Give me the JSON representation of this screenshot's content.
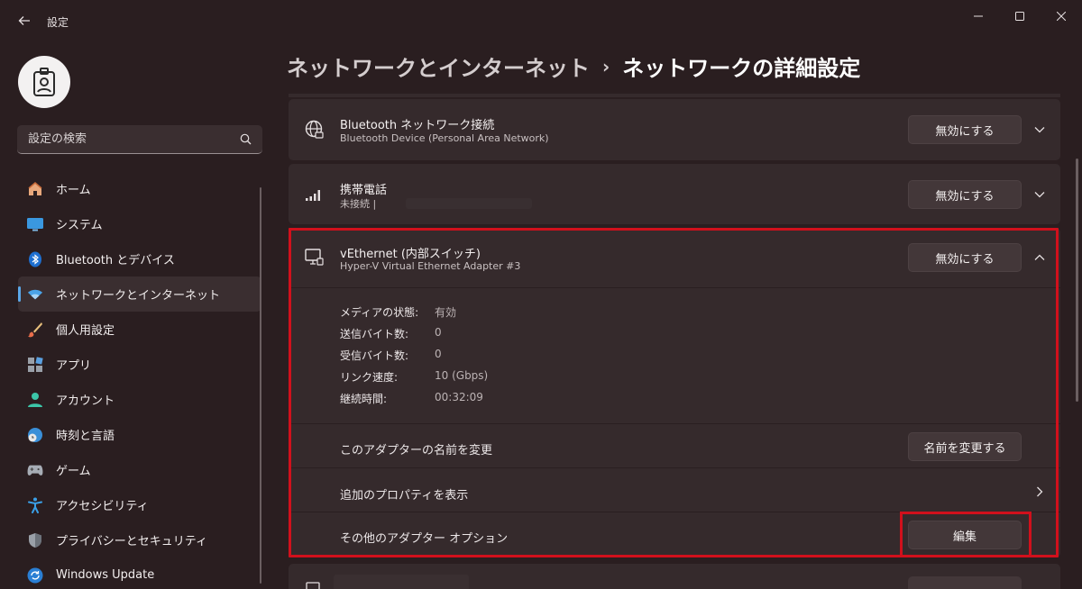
{
  "window": {
    "title": "設定"
  },
  "sidebar": {
    "search_placeholder": "設定の検索",
    "items": [
      {
        "label": "ホーム",
        "icon": "home-icon"
      },
      {
        "label": "システム",
        "icon": "monitor-icon"
      },
      {
        "label": "Bluetooth とデバイス",
        "icon": "bluetooth-icon"
      },
      {
        "label": "ネットワークとインターネット",
        "icon": "wifi-icon",
        "active": true
      },
      {
        "label": "個人用設定",
        "icon": "brush-icon"
      },
      {
        "label": "アプリ",
        "icon": "apps-icon"
      },
      {
        "label": "アカウント",
        "icon": "person-icon"
      },
      {
        "label": "時刻と言語",
        "icon": "globe-clock-icon"
      },
      {
        "label": "ゲーム",
        "icon": "gamepad-icon"
      },
      {
        "label": "アクセシビリティ",
        "icon": "accessibility-icon"
      },
      {
        "label": "プライバシーとセキュリティ",
        "icon": "shield-icon"
      },
      {
        "label": "Windows Update",
        "icon": "update-icon"
      }
    ]
  },
  "header": {
    "parent": "ネットワークとインターネット",
    "separator": "›",
    "current": "ネットワークの詳細設定"
  },
  "adapters": [
    {
      "title": "Bluetooth ネットワーク接続",
      "subtitle": "Bluetooth Device (Personal Area Network)",
      "button": "無効にする",
      "icon": "globe-network-icon"
    },
    {
      "title": "携帯電話",
      "subtitle": "未接続 |",
      "button": "無効にする",
      "icon": "signal-bars-icon"
    },
    {
      "title": "vEthernet (内部スイッチ)",
      "subtitle": "Hyper-V Virtual Ethernet Adapter #3",
      "button": "無効にする",
      "icon": "ethernet-monitor-icon",
      "properties": [
        {
          "label": "メディアの状態:",
          "value": "有効"
        },
        {
          "label": "送信バイト数:",
          "value": "0"
        },
        {
          "label": "受信バイト数:",
          "value": "0"
        },
        {
          "label": "リンク速度:",
          "value": "10 (Gbps)"
        },
        {
          "label": "継続時間:",
          "value": "00:32:09"
        }
      ],
      "rename_label": "このアダプターの名前を変更",
      "rename_button": "名前を変更する",
      "more_props_label": "追加のプロパティを表示",
      "other_options_label": "その他のアダプター オプション",
      "edit_button": "編集"
    }
  ],
  "colors": {
    "background": "#2a1e20",
    "card": "#352a2c",
    "accent": "#5ba7e8",
    "highlight": "#d1101c"
  }
}
